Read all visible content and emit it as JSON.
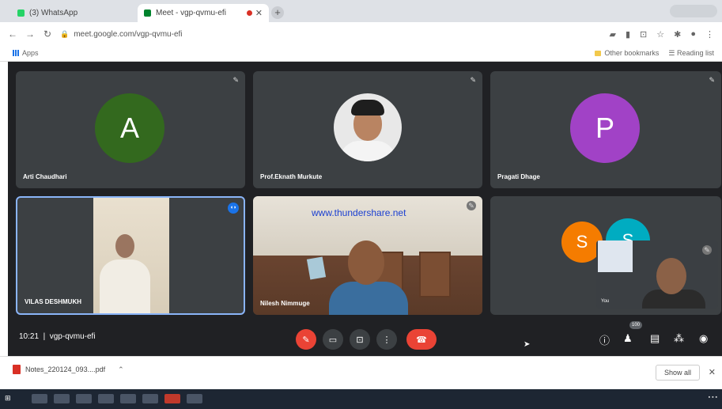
{
  "browser": {
    "tabs": [
      {
        "title": "(3) WhatsApp",
        "favicon_color": "#25d366",
        "active": false
      },
      {
        "title": "Meet - vgp-qvmu-efi",
        "favicon_color": "#00832d",
        "active": true
      }
    ],
    "url": "meet.google.com/vgp-qvmu-efi",
    "bookmarks": {
      "apps_label": "Apps",
      "other_bookmarks": "Other bookmarks",
      "reading_list": "Reading list"
    }
  },
  "meet": {
    "participants": [
      {
        "name": "Arti Chaudhari",
        "avatar_letter": "A",
        "avatar_color": "#33691e"
      },
      {
        "name": "Prof.Eknath Murkute"
      },
      {
        "name": "Pragati Dhage",
        "avatar_letter": "P",
        "avatar_color": "#a142c6"
      },
      {
        "name": "VILAS DESHMUKH"
      },
      {
        "name": "Nilesh Nimmuge"
      },
      {
        "name": "You",
        "overflow_letters": [
          "S",
          "S"
        ],
        "overflow_colors": [
          "#f57c00",
          "#00acc1"
        ]
      }
    ],
    "watermark": "www.thundershare.net",
    "time": "10:21",
    "meeting_code": "vgp-qvmu-efi",
    "people_badge": "100",
    "accent": "#ea4335"
  },
  "downloads": {
    "file": "Notes_220124_093....pdf",
    "show_all": "Show all"
  }
}
